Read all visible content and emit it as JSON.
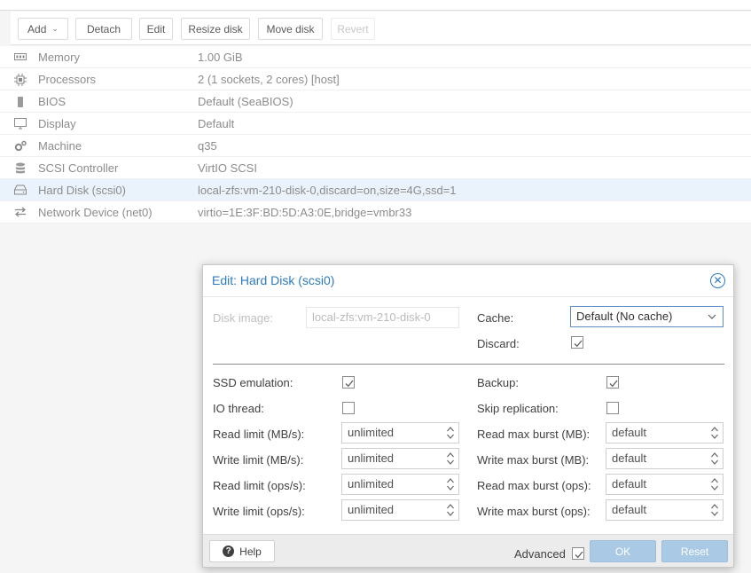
{
  "toolbar": {
    "add": "Add",
    "detach": "Detach",
    "edit": "Edit",
    "resize": "Resize disk",
    "move": "Move disk",
    "revert": "Revert"
  },
  "hardware": [
    {
      "icon": "memory-icon",
      "name": "Memory",
      "value": "1.00 GiB"
    },
    {
      "icon": "cpu-icon",
      "name": "Processors",
      "value": "2 (1 sockets, 2 cores) [host]"
    },
    {
      "icon": "chip-icon",
      "name": "BIOS",
      "value": "Default (SeaBIOS)"
    },
    {
      "icon": "monitor-icon",
      "name": "Display",
      "value": "Default"
    },
    {
      "icon": "cogs-icon",
      "name": "Machine",
      "value": "q35"
    },
    {
      "icon": "database-icon",
      "name": "SCSI Controller",
      "value": "VirtIO SCSI"
    },
    {
      "icon": "hdd-icon",
      "name": "Hard Disk (scsi0)",
      "value": "local-zfs:vm-210-disk-0,discard=on,size=4G,ssd=1"
    },
    {
      "icon": "exchange-icon",
      "name": "Network Device (net0)",
      "value": "virtio=1E:3F:BD:5D:A3:0E,bridge=vmbr33"
    }
  ],
  "dialog": {
    "title": "Edit: Hard Disk (scsi0)",
    "disk_image_label": "Disk image:",
    "disk_image_value": "local-zfs:vm-210-disk-0",
    "cache_label": "Cache:",
    "cache_value": "Default (No cache)",
    "discard_label": "Discard:",
    "discard_checked": true,
    "ssd_label": "SSD emulation:",
    "ssd_checked": true,
    "iothread_label": "IO thread:",
    "iothread_checked": false,
    "backup_label": "Backup:",
    "backup_checked": true,
    "skiprep_label": "Skip replication:",
    "skiprep_checked": false,
    "limits_left": [
      {
        "label": "Read limit (MB/s):",
        "value": "unlimited"
      },
      {
        "label": "Write limit (MB/s):",
        "value": "unlimited"
      },
      {
        "label": "Read limit (ops/s):",
        "value": "unlimited"
      },
      {
        "label": "Write limit (ops/s):",
        "value": "unlimited"
      }
    ],
    "limits_right": [
      {
        "label": "Read max burst (MB):",
        "value": "default"
      },
      {
        "label": "Write max burst (MB):",
        "value": "default"
      },
      {
        "label": "Read max burst (ops):",
        "value": "default"
      },
      {
        "label": "Write max burst (ops):",
        "value": "default"
      }
    ],
    "help": "Help",
    "advanced_label": "Advanced",
    "advanced_checked": true,
    "ok": "OK",
    "reset": "Reset"
  }
}
